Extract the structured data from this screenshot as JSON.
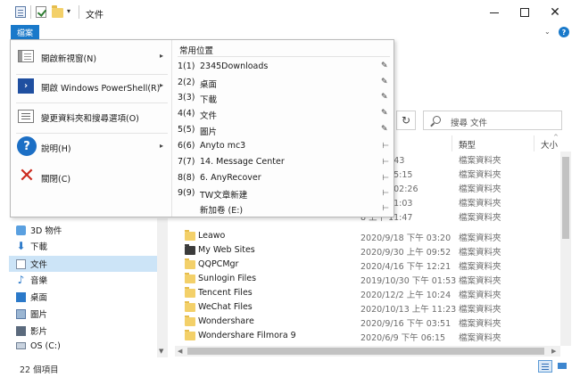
{
  "window": {
    "title": "文件",
    "controls": {
      "minimize": "",
      "maximize": "",
      "close": "✕"
    }
  },
  "ribbon": {
    "file_tab": "檔案",
    "chevron": "⌄",
    "help": "?"
  },
  "toolbar": {
    "refresh_icon": "↻",
    "search_placeholder": "搜尋 文件"
  },
  "columns": {
    "type": "類型",
    "size": "大小"
  },
  "nav": {
    "items": [
      {
        "label": "3D 物件",
        "icon": "cube-icon"
      },
      {
        "label": "下載",
        "icon": "download-icon"
      },
      {
        "label": "文件",
        "icon": "document-icon",
        "selected": true
      },
      {
        "label": "音樂",
        "icon": "music-icon"
      },
      {
        "label": "桌面",
        "icon": "desktop-icon"
      },
      {
        "label": "圖片",
        "icon": "picture-icon"
      },
      {
        "label": "影片",
        "icon": "video-icon"
      },
      {
        "label": "OS (C:)",
        "icon": "drive-icon"
      }
    ]
  },
  "files": [
    {
      "name": "",
      "date": "下午 01:43",
      "type": "檔案資料夾"
    },
    {
      "name": "",
      "date": "9 下午 05:15",
      "type": "檔案資料夾"
    },
    {
      "name": "",
      "date": "28 下午 02:26",
      "type": "檔案資料夾"
    },
    {
      "name": "",
      "date": "5 上午 11:03",
      "type": "檔案資料夾"
    },
    {
      "name": "",
      "date": "8 上午 11:47",
      "type": "檔案資料夾"
    },
    {
      "name": "Leawo",
      "date": "2020/9/18 下午 03:20",
      "type": "檔案資料夾"
    },
    {
      "name": "My Web Sites",
      "date": "2020/9/30 上午 09:52",
      "type": "檔案資料夾",
      "special": true
    },
    {
      "name": "QQPCMgr",
      "date": "2020/4/16 下午 12:21",
      "type": "檔案資料夾"
    },
    {
      "name": "Sunlogin Files",
      "date": "2019/10/30 下午 01:53",
      "type": "檔案資料夾"
    },
    {
      "name": "Tencent Files",
      "date": "2020/12/2 上午 10:24",
      "type": "檔案資料夾"
    },
    {
      "name": "WeChat Files",
      "date": "2020/10/13 上午 11:23",
      "type": "檔案資料夾"
    },
    {
      "name": "Wondershare",
      "date": "2020/9/16 下午 03:51",
      "type": "檔案資料夾"
    },
    {
      "name": "Wondershare Filmora 9",
      "date": "2020/6/9 下午 06:15",
      "type": "檔案資料夾"
    }
  ],
  "status": {
    "item_count": "22 個項目"
  },
  "file_menu": {
    "items": [
      {
        "label": "開啟新視窗(N)",
        "icon": "new-window-icon",
        "has_submenu": true
      },
      {
        "label": "開啟 Windows PowerShell(R)",
        "icon": "powershell-icon",
        "has_submenu": true
      },
      {
        "label": "變更資料夾和搜尋選項(O)",
        "icon": "folder-options-icon",
        "has_submenu": false
      },
      {
        "label": "說明(H)",
        "icon": "help-icon",
        "has_submenu": true
      },
      {
        "label": "關閉(C)",
        "icon": "close-x-icon",
        "has_submenu": false
      }
    ],
    "submenu_arrow": "▸",
    "recent_title": "常用位置",
    "recent": [
      {
        "num": "1(1)",
        "name": "2345Downloads",
        "pinned": true
      },
      {
        "num": "2(2)",
        "name": "桌面",
        "pinned": true
      },
      {
        "num": "3(3)",
        "name": "下載",
        "pinned": true
      },
      {
        "num": "4(4)",
        "name": "文件",
        "pinned": true
      },
      {
        "num": "5(5)",
        "name": "圖片",
        "pinned": true
      },
      {
        "num": "6(6)",
        "name": "Anyto mc3",
        "pinned": false
      },
      {
        "num": "7(7)",
        "name": "14. Message Center",
        "pinned": false
      },
      {
        "num": "8(8)",
        "name": "6. AnyRecover",
        "pinned": false
      },
      {
        "num": "9(9)",
        "name": "TW文章新建",
        "pinned": false
      },
      {
        "num": "",
        "name": "新加卷 (E:)",
        "pinned": false
      }
    ],
    "pin_glyph": "📌",
    "unpin_glyph": "⊸"
  },
  "colors": {
    "accent": "#1979ca",
    "selection": "#cce4f7",
    "folder": "#f3d069",
    "close_red": "#cc2b1f"
  }
}
